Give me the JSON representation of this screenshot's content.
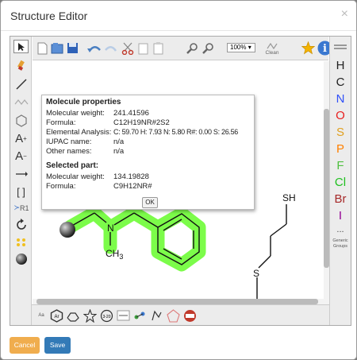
{
  "dialog": {
    "title": "Structure Editor",
    "close": "×"
  },
  "toolbar": {
    "zoom": "100%",
    "clean": "Clean"
  },
  "atoms": [
    {
      "symbol": "H",
      "color": "#222222"
    },
    {
      "symbol": "C",
      "color": "#222222"
    },
    {
      "symbol": "N",
      "color": "#3050F8"
    },
    {
      "symbol": "O",
      "color": "#E82020"
    },
    {
      "symbol": "S",
      "color": "#E0A020"
    },
    {
      "symbol": "P",
      "color": "#FF8000"
    },
    {
      "symbol": "F",
      "color": "#50C040"
    },
    {
      "symbol": "Cl",
      "color": "#1FC01F"
    },
    {
      "symbol": "Br",
      "color": "#A62929"
    },
    {
      "symbol": "I",
      "color": "#940094"
    }
  ],
  "more_atoms": "...",
  "generic_groups": [
    "Generic",
    "Groups"
  ],
  "properties": {
    "heading": "Molecule properties",
    "rows": [
      {
        "label": "Molecular weight:",
        "value": "241.41596"
      },
      {
        "label": "Formula:",
        "value": "C12H19NR#2S2"
      },
      {
        "label": "Elemental Analysis:",
        "value": "C: 59.70 H: 7.93 N: 5.80 R#: 0.00 S: 26.56"
      },
      {
        "label": "IUPAC name:",
        "value": "n/a"
      },
      {
        "label": "Other names:",
        "value": "n/a"
      }
    ],
    "selected_heading": "Selected part:",
    "selected_rows": [
      {
        "label": "Molecular weight:",
        "value": "134.19828"
      },
      {
        "label": "Formula:",
        "value": "C9H12NR#"
      }
    ],
    "ok": "OK"
  },
  "molecule": {
    "n_label": "N",
    "ch3_label": "CH",
    "ch3_sub": "3",
    "sh_label": "SH",
    "s_label": "S"
  },
  "footer": {
    "cancel": "Cancel",
    "save": "Save"
  },
  "colors": {
    "cancel": "#f0ad4e",
    "save": "#337ab7",
    "highlight": "#7CFC4A"
  }
}
